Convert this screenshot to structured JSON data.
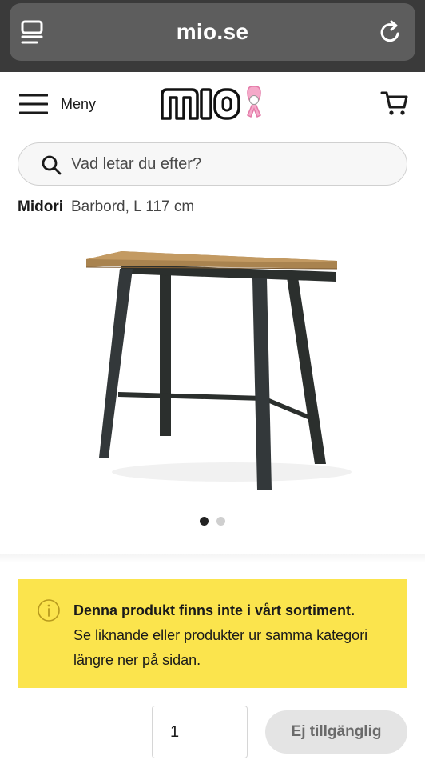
{
  "browser": {
    "url": "mio.se"
  },
  "header": {
    "menu_label": "Meny",
    "logo_text": "mio"
  },
  "search": {
    "placeholder": "Vad letar du efter?"
  },
  "product": {
    "brand": "Midori",
    "description": "Barbord, L 117 cm",
    "image_count": 2,
    "active_image": 1
  },
  "notice": {
    "title": "Denna produkt finns inte i vårt sortiment.",
    "body_line1": "Se liknande eller produkter ur samma kategori",
    "body_line2": "längre ner på sidan."
  },
  "purchase": {
    "quantity": "1",
    "button_label": "Ej tillgänglig"
  },
  "colors": {
    "notice_bg": "#fbe44d",
    "browser_bg": "#3a3a3a",
    "button_disabled": "#e4e4e4"
  }
}
